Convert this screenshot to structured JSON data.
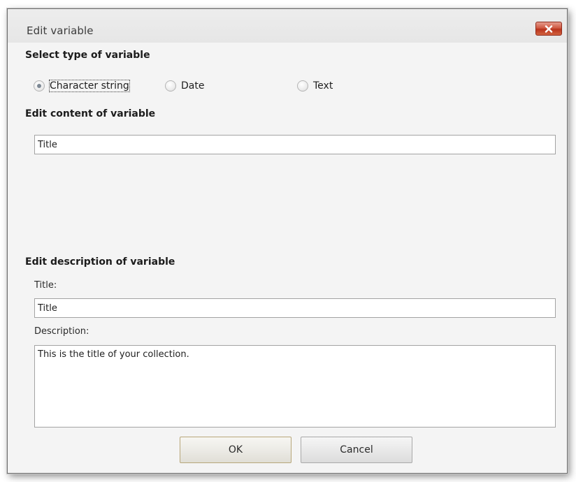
{
  "window": {
    "title": "Edit variable",
    "close_icon": "close-icon",
    "close_color": "#c8452b"
  },
  "type_section": {
    "heading": "Select type of variable",
    "options": [
      {
        "label": "Character string",
        "checked": true
      },
      {
        "label": "Date",
        "checked": false
      },
      {
        "label": "Text",
        "checked": false
      }
    ]
  },
  "content_section": {
    "heading": "Edit content of variable",
    "value": "Title"
  },
  "description_section": {
    "heading": "Edit description of variable",
    "title_label": "Title:",
    "title_value": "Title",
    "description_label": "Description:",
    "description_value": "This is the title of your collection."
  },
  "buttons": {
    "ok_label": "OK",
    "cancel_label": "Cancel"
  }
}
